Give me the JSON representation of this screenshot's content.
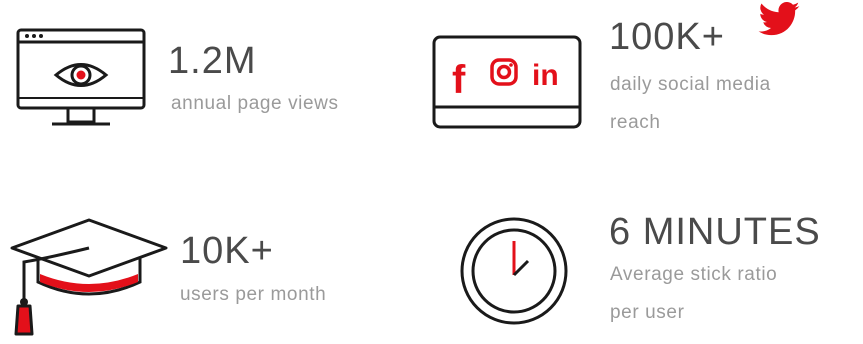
{
  "stats": [
    {
      "value": "1.2M",
      "label": "annual page views"
    },
    {
      "value": "100K+",
      "label_lines": [
        "daily social media",
        "reach"
      ]
    },
    {
      "value": "10K+",
      "label": "users per month"
    },
    {
      "value": "6 MINUTES",
      "label_lines": [
        "Average stick ratio",
        "per user"
      ]
    }
  ],
  "social_icons": {
    "facebook": "f",
    "linkedin": "in"
  },
  "colors": {
    "accent": "#e3101a",
    "outline": "#1a1a1a",
    "value_text": "#4a4a4a",
    "label_text": "#9a9a9a",
    "background": "#ffffff"
  }
}
